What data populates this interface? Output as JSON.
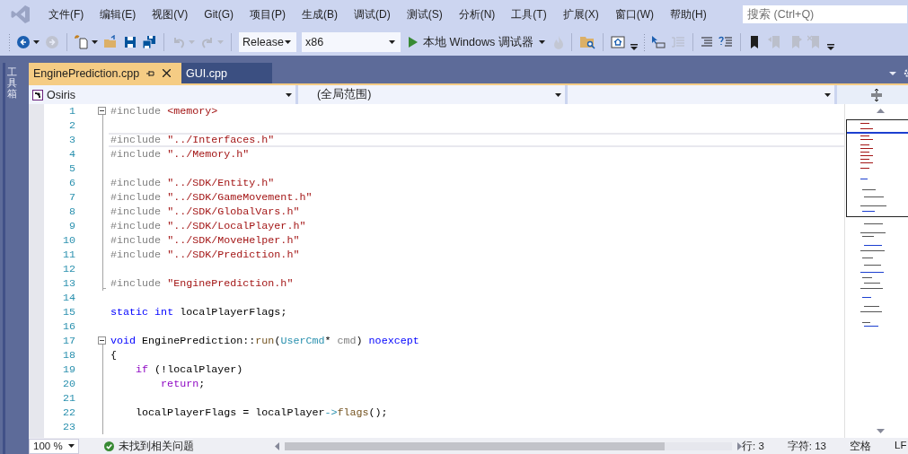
{
  "menu": [
    "文件(F)",
    "编辑(E)",
    "视图(V)",
    "Git(G)",
    "项目(P)",
    "生成(B)",
    "调试(D)",
    "测试(S)",
    "分析(N)",
    "工具(T)",
    "扩展(X)",
    "窗口(W)",
    "帮助(H)"
  ],
  "search": {
    "placeholder": "搜索 (Ctrl+Q)"
  },
  "toolbar": [
    {
      "kind": "grip"
    },
    {
      "kind": "back",
      "disabled": false
    },
    {
      "kind": "caret",
      "disabled": false
    },
    {
      "kind": "forward",
      "disabled": true
    },
    {
      "kind": "sep"
    },
    {
      "kind": "new-item",
      "disabled": false
    },
    {
      "kind": "caret",
      "disabled": false
    },
    {
      "kind": "open",
      "disabled": false
    },
    {
      "kind": "save",
      "disabled": false
    },
    {
      "kind": "save-all",
      "disabled": false
    },
    {
      "kind": "sep"
    },
    {
      "kind": "undo",
      "disabled": true
    },
    {
      "kind": "caret",
      "disabled": true
    },
    {
      "kind": "redo",
      "disabled": true
    },
    {
      "kind": "caret",
      "disabled": true
    },
    {
      "kind": "sep"
    },
    {
      "kind": "config"
    },
    {
      "kind": "platform"
    },
    {
      "kind": "run"
    },
    {
      "kind": "flame",
      "disabled": true
    },
    {
      "kind": "sep"
    },
    {
      "kind": "find-files",
      "disabled": false
    },
    {
      "kind": "sep"
    },
    {
      "kind": "home",
      "disabled": false
    },
    {
      "kind": "overflow",
      "disabled": false
    },
    {
      "kind": "grip"
    },
    {
      "kind": "step",
      "disabled": false
    },
    {
      "kind": "outdent",
      "disabled": true
    },
    {
      "kind": "sep"
    },
    {
      "kind": "comment",
      "disabled": false
    },
    {
      "kind": "uncomment",
      "disabled": false
    },
    {
      "kind": "sep"
    },
    {
      "kind": "bookmark",
      "disabled": false
    },
    {
      "kind": "bookmark-prev",
      "disabled": true
    },
    {
      "kind": "bookmark-next",
      "disabled": true
    },
    {
      "kind": "bookmark-clear",
      "disabled": true
    },
    {
      "kind": "overflow",
      "disabled": false
    }
  ],
  "configuration": "Release",
  "platform": "x86",
  "run_button": "本地 Windows 调试器",
  "toolbox_tab": "工具箱",
  "tabs": [
    {
      "label": "EnginePrediction.cpp",
      "selected": true
    },
    {
      "label": "GUI.cpp",
      "selected": false
    }
  ],
  "nav_bar": {
    "project": "Osiris",
    "scope": "(全局范围)"
  },
  "code_lines": [
    {
      "number": "1",
      "kind": "start",
      "current": false,
      "tokens": [
        {
          "kind": "directive",
          "text": "#include "
        },
        {
          "kind": "string",
          "text": "<memory>"
        }
      ]
    },
    {
      "number": "2",
      "kind": "inside",
      "current": false
    },
    {
      "number": "3",
      "kind": "inside",
      "current": true,
      "tokens": [
        {
          "kind": "directive",
          "text": "#include "
        },
        {
          "kind": "string",
          "text": "\"../Interfaces.h\""
        }
      ]
    },
    {
      "number": "4",
      "kind": "inside",
      "current": false,
      "tokens": [
        {
          "kind": "directive",
          "text": "#include "
        },
        {
          "kind": "string",
          "text": "\"../Memory.h\""
        }
      ]
    },
    {
      "number": "5",
      "kind": "inside",
      "current": false
    },
    {
      "number": "6",
      "kind": "inside",
      "current": false,
      "tokens": [
        {
          "kind": "directive",
          "text": "#include "
        },
        {
          "kind": "string",
          "text": "\"../SDK/Entity.h\""
        }
      ]
    },
    {
      "number": "7",
      "kind": "inside",
      "current": false,
      "tokens": [
        {
          "kind": "directive",
          "text": "#include "
        },
        {
          "kind": "string",
          "text": "\"../SDK/GameMovement.h\""
        }
      ]
    },
    {
      "number": "8",
      "kind": "inside",
      "current": false,
      "tokens": [
        {
          "kind": "directive",
          "text": "#include "
        },
        {
          "kind": "string",
          "text": "\"../SDK/GlobalVars.h\""
        }
      ]
    },
    {
      "number": "9",
      "kind": "inside",
      "current": false,
      "tokens": [
        {
          "kind": "directive",
          "text": "#include "
        },
        {
          "kind": "string",
          "text": "\"../SDK/LocalPlayer.h\""
        }
      ]
    },
    {
      "number": "10",
      "kind": "inside",
      "current": false,
      "tokens": [
        {
          "kind": "directive",
          "text": "#include "
        },
        {
          "kind": "string",
          "text": "\"../SDK/MoveHelper.h\""
        }
      ]
    },
    {
      "number": "11",
      "kind": "inside",
      "current": false,
      "tokens": [
        {
          "kind": "directive",
          "text": "#include "
        },
        {
          "kind": "string",
          "text": "\"../SDK/Prediction.h\""
        }
      ]
    },
    {
      "number": "12",
      "kind": "inside",
      "current": false
    },
    {
      "number": "13",
      "kind": "end",
      "current": false,
      "tokens": [
        {
          "kind": "directive",
          "text": "#include "
        },
        {
          "kind": "string",
          "text": "\"EnginePrediction.h\""
        }
      ]
    },
    {
      "number": "14",
      "kind": "plain",
      "current": false
    },
    {
      "number": "15",
      "kind": "plain",
      "current": false,
      "tokens": [
        {
          "kind": "keyword",
          "text": "static"
        },
        {
          "kind": "keyword",
          "text": " int"
        },
        {
          "kind": "plain",
          "text": " localPlayerFlags;"
        }
      ]
    },
    {
      "number": "16",
      "kind": "plain",
      "current": false
    },
    {
      "number": "17",
      "kind": "start",
      "current": false,
      "tokens": [
        {
          "kind": "keyword",
          "text": "void"
        },
        {
          "kind": "plain",
          "text": " EnginePrediction::"
        },
        {
          "kind": "function",
          "text": "run"
        },
        {
          "kind": "plain",
          "text": "("
        },
        {
          "kind": "type",
          "text": "UserCmd"
        },
        {
          "kind": "plain",
          "text": "* "
        },
        {
          "kind": "param",
          "text": "cmd"
        },
        {
          "kind": "plain",
          "text": ") "
        },
        {
          "kind": "keyword",
          "text": "noexcept"
        }
      ]
    },
    {
      "number": "18",
      "kind": "inside",
      "current": false,
      "tokens": [
        {
          "kind": "plain",
          "text": "{"
        }
      ]
    },
    {
      "number": "19",
      "kind": "inside",
      "current": false,
      "tokens": [
        {
          "kind": "control",
          "text": "    if"
        },
        {
          "kind": "plain",
          "text": " (!localPlayer)"
        }
      ]
    },
    {
      "number": "20",
      "kind": "inside",
      "current": false,
      "tokens": [
        {
          "kind": "control",
          "text": "        return"
        },
        {
          "kind": "plain",
          "text": ";"
        }
      ]
    },
    {
      "number": "21",
      "kind": "inside",
      "current": false
    },
    {
      "number": "22",
      "kind": "inside",
      "current": false,
      "tokens": [
        {
          "kind": "plain",
          "text": "    localPlayerFlags = localPlayer"
        },
        {
          "kind": "type",
          "text": "->"
        },
        {
          "kind": "function",
          "text": "flags"
        },
        {
          "kind": "plain",
          "text": "();"
        }
      ]
    },
    {
      "number": "23",
      "kind": "inside",
      "current": false
    }
  ],
  "status": {
    "zoom": "100 %",
    "issues": "未找到相关问题",
    "line": "行: 3",
    "column": "字符: 13",
    "indent": "空格",
    "line_ending": "LF"
  }
}
